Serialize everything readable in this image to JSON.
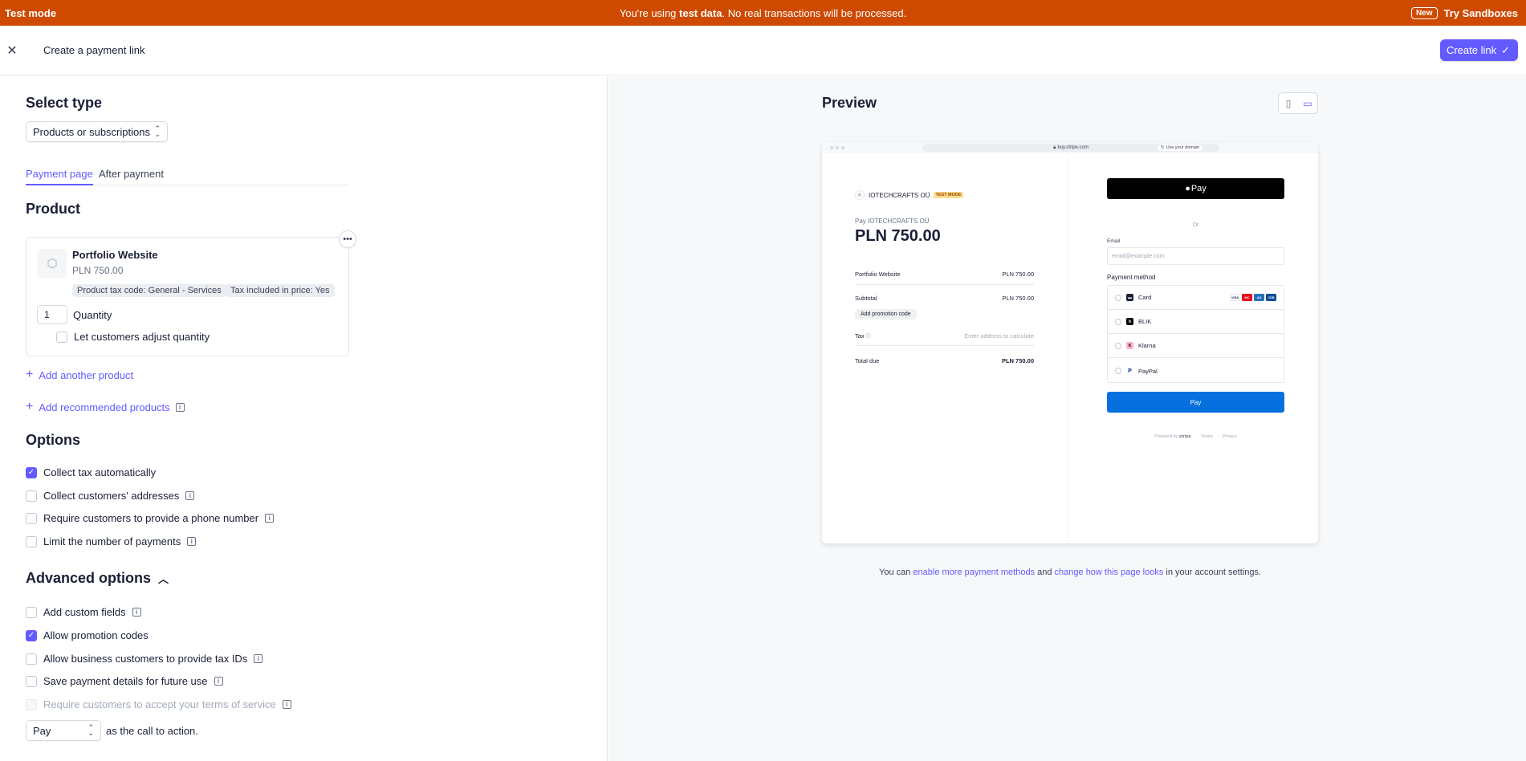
{
  "banner": {
    "mode_label": "Test mode",
    "message_prefix": "You're using ",
    "message_bold": "test data",
    "message_suffix": ". No real transactions will be processed.",
    "new_badge": "New",
    "try_label": "Try Sandboxes"
  },
  "header": {
    "title": "Create a payment link",
    "create_button": "Create link"
  },
  "left": {
    "select_type_heading": "Select type",
    "type_select_value": "Products or subscriptions",
    "tabs": [
      {
        "label": "Payment page",
        "active": true
      },
      {
        "label": "After payment",
        "active": false
      }
    ],
    "product_heading": "Product",
    "product": {
      "name": "Portfolio Website",
      "price": "PLN 750.00",
      "badges": [
        "Product tax code: General - Services",
        "Tax included in price: Yes"
      ],
      "quantity": "1",
      "quantity_label": "Quantity",
      "adjust_label": "Let customers adjust quantity"
    },
    "add_product": "Add another product",
    "add_recommended": "Add recommended products",
    "options_heading": "Options",
    "options": [
      {
        "label": "Collect tax automatically",
        "checked": true
      },
      {
        "label": "Collect customers' addresses",
        "checked": false
      },
      {
        "label": "Require customers to provide a phone number",
        "checked": false
      },
      {
        "label": "Limit the number of payments",
        "checked": false
      }
    ],
    "advanced_heading": "Advanced options",
    "advanced": [
      {
        "label": "Add custom fields",
        "checked": false
      },
      {
        "label": "Allow promotion codes",
        "checked": true
      },
      {
        "label": "Allow business customers to provide tax IDs",
        "checked": false
      },
      {
        "label": "Save payment details for future use",
        "checked": false
      },
      {
        "label": "Require customers to accept your terms of service",
        "checked": false,
        "disabled": true
      }
    ],
    "cta_select_value": "Pay",
    "cta_suffix": "as the call to action."
  },
  "preview": {
    "title": "Preview",
    "url": "buy.stripe.com",
    "use_domain": "Use your domain",
    "merchant": "IOTECHCRAFTS OÜ",
    "test_badge": "TEST MODE",
    "pay_to": "Pay IOTECHCRAFTS OÜ",
    "amount": "PLN 750.00",
    "line_item_name": "Portfolio Website",
    "line_item_price": "PLN 750.00",
    "subtotal_label": "Subtotal",
    "subtotal_value": "PLN 750.00",
    "promo_button": "Add promotion code",
    "tax_label": "Tax",
    "tax_value": "Enter address to calculate",
    "total_label": "Total due",
    "total_value": "PLN 750.00",
    "apple_pay": "Pay",
    "or": "Or",
    "email_label": "Email",
    "email_placeholder": "email@example.com",
    "payment_method_label": "Payment method",
    "methods": [
      "Card",
      "BLIK",
      "Klarna",
      "PayPal"
    ],
    "pay_button": "Pay",
    "powered_by": "Powered by",
    "stripe": "stripe",
    "terms": "Terms",
    "privacy": "Privacy"
  },
  "footer": {
    "prefix": "You can ",
    "link1": "enable more payment methods",
    "middle": " and ",
    "link2": "change how this page looks",
    "suffix": " in your account settings."
  },
  "colors": {
    "banner": "#cd4a00",
    "accent": "#635bff",
    "pay_button": "#0570de"
  }
}
